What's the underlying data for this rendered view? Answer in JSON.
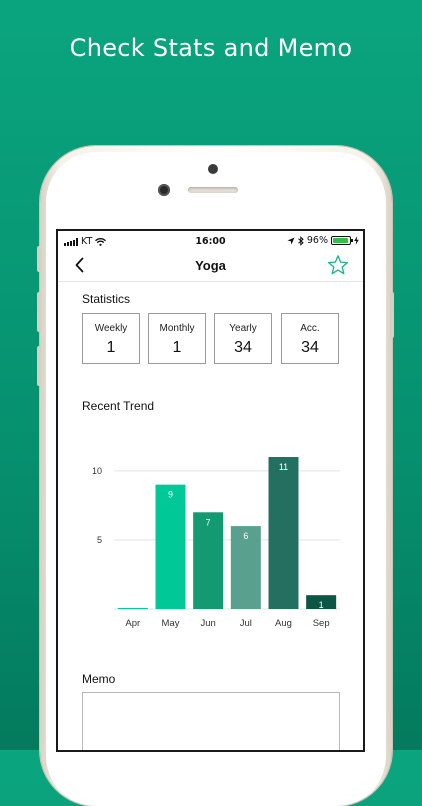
{
  "promo": {
    "headline": "Check Stats and Memo"
  },
  "status_bar": {
    "carrier": "KT",
    "time": "16:00",
    "battery": "96%"
  },
  "nav": {
    "title": "Yoga",
    "back_icon": "chevron-left-icon",
    "favorite_icon": "star-outline-icon"
  },
  "statistics": {
    "title": "Statistics",
    "boxes": [
      {
        "label": "Weekly",
        "value": "1"
      },
      {
        "label": "Monthly",
        "value": "1"
      },
      {
        "label": "Yearly",
        "value": "34"
      },
      {
        "label": "Acc.",
        "value": "34"
      }
    ]
  },
  "trend": {
    "title": "Recent Trend"
  },
  "memo": {
    "title": "Memo",
    "value": ""
  },
  "colors": {
    "accent": "#0aa57f",
    "bar_colors": [
      "#00c896",
      "#00c896",
      "#149a73",
      "#5aa08e",
      "#237060",
      "#0d5545"
    ]
  },
  "chart_data": {
    "type": "bar",
    "categories": [
      "Apr",
      "May",
      "Jun",
      "Jul",
      "Aug",
      "Sep"
    ],
    "values": [
      0,
      9,
      7,
      6,
      11,
      1
    ],
    "data_labels": [
      "",
      "9",
      "7",
      "6",
      "11",
      "1"
    ],
    "yticks": [
      "5",
      "10"
    ],
    "ylim": [
      0,
      11
    ],
    "grid": true
  }
}
